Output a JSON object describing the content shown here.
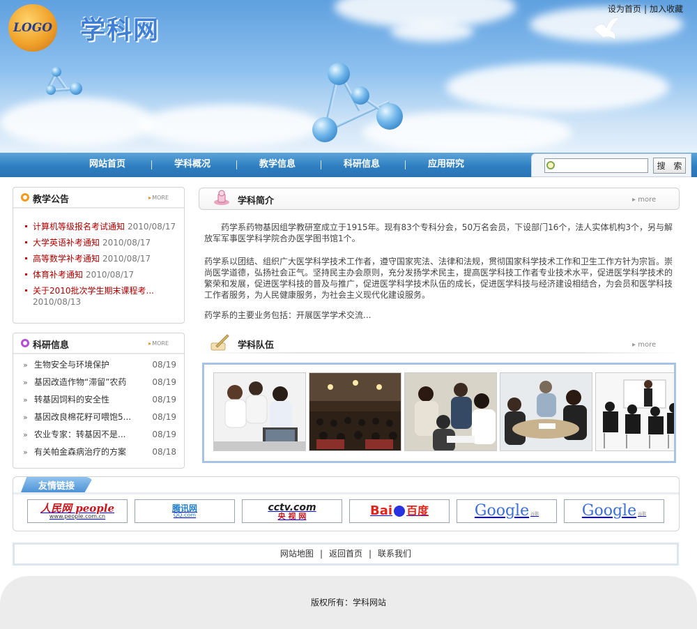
{
  "header": {
    "logo_text": "LOGO",
    "site_title": "学科网",
    "top_links": [
      "设为首页",
      "加入收藏"
    ]
  },
  "nav": {
    "items": [
      "网站首页",
      "学科概况",
      "教学信息",
      "科研信息",
      "应用研究"
    ],
    "search_placeholder": "",
    "search_button": "搜 索"
  },
  "notices": {
    "title": "教学公告",
    "more": "MORE",
    "items": [
      {
        "title": "计算机等级报名考试通知",
        "date": "2010/08/17"
      },
      {
        "title": "大学英语补考通知",
        "date": "2010/08/17"
      },
      {
        "title": "高等数学补考通知",
        "date": "2010/08/17"
      },
      {
        "title": "体育补考通知",
        "date": "2010/08/17"
      },
      {
        "title": "关于2010批次学生期末课程考...",
        "date": "2010/08/13"
      }
    ]
  },
  "research": {
    "title": "科研信息",
    "more": "MORE",
    "items": [
      {
        "title": "生物安全与环境保护",
        "date": "08/19"
      },
      {
        "title": "基因改造作物“滞留”农药",
        "date": "08/19"
      },
      {
        "title": "转基因饲料的安全性",
        "date": "08/19"
      },
      {
        "title": "基因改良棉花籽可喂饱5...",
        "date": "08/19"
      },
      {
        "title": "农业专家：转基因不是...",
        "date": "08/19"
      },
      {
        "title": "有关帕金森病治疗的方案",
        "date": "08/18"
      }
    ]
  },
  "intro": {
    "title": "学科简介",
    "more": "more",
    "paragraphs": [
      "　　药学系药物基因组学教研室成立于1915年。现有83个专科分会，50万名会员，下设部门16个，法人实体机构3个，另与解放军军事医学科学院合办医学图书馆1个。",
      "药学系以团结、组织广大医学科学技术工作者，遵守国家宪法、法律和法规，贯彻国家科学技术工作和卫生工作方针为宗旨。崇尚医学道德，弘扬社会正气。坚持民主办会原则，充分发扬学术民主，提高医学科技工作者专业技术水平，促进医学科学技术的繁荣和发展，促进医学科技的普及与推广，促进医学科学技术队伍的成长，促进医学科技与经济建设相结合，为会员和医学科技工作者服务，为人民健康服务，为社会主义现代化建设服务。",
      "药学系的主要业务包括：开展医学学术交流..."
    ]
  },
  "team": {
    "title": "学科队伍",
    "more": "more"
  },
  "links": {
    "title": "友情链接",
    "logos": [
      {
        "name": "people",
        "text": "人民网 people",
        "sub": "www.people.com.cn"
      },
      {
        "name": "qq",
        "text": "腾讯网",
        "sub": "QQ.com"
      },
      {
        "name": "cctv",
        "text": "cctv.com",
        "sub": "央 视 网"
      },
      {
        "name": "baidu",
        "text": "Bai",
        "sub": "百度"
      },
      {
        "name": "google",
        "text": "Google",
        "sub": "谷歌"
      },
      {
        "name": "google2",
        "text": "Google",
        "sub": "谷歌"
      }
    ]
  },
  "footer": {
    "links": [
      "网站地图",
      "返回首页",
      "联系我们"
    ],
    "copyright": "版权所有：学科网站"
  },
  "colors": {
    "accent_blue": "#2f7fc0",
    "notice_red": "#b00000",
    "team_border": "#a9c3e6"
  }
}
